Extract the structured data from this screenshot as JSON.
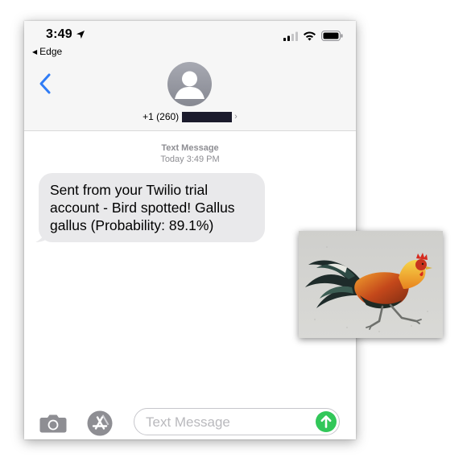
{
  "status_bar": {
    "time": "3:49",
    "back_app": "Edge"
  },
  "contact": {
    "phone_visible": "+1 (260)"
  },
  "conversation": {
    "service": "Text Message",
    "timestamp": "Today 3:49 PM",
    "messages": [
      {
        "text": "Sent from your Twilio trial account - Bird spotted! Gallus gallus (Probability: 89.1%)"
      }
    ]
  },
  "composer": {
    "placeholder": "Text Message"
  },
  "colors": {
    "ios_blue": "#2f7cf6",
    "send_green": "#32c759",
    "bubble_gray": "#e9e9eb"
  },
  "icons": [
    "location-arrow-icon",
    "signal-icon",
    "wifi-icon",
    "battery-icon",
    "back-chevron-icon",
    "contact-avatar-icon",
    "camera-icon",
    "app-store-icon",
    "send-arrow-icon"
  ]
}
